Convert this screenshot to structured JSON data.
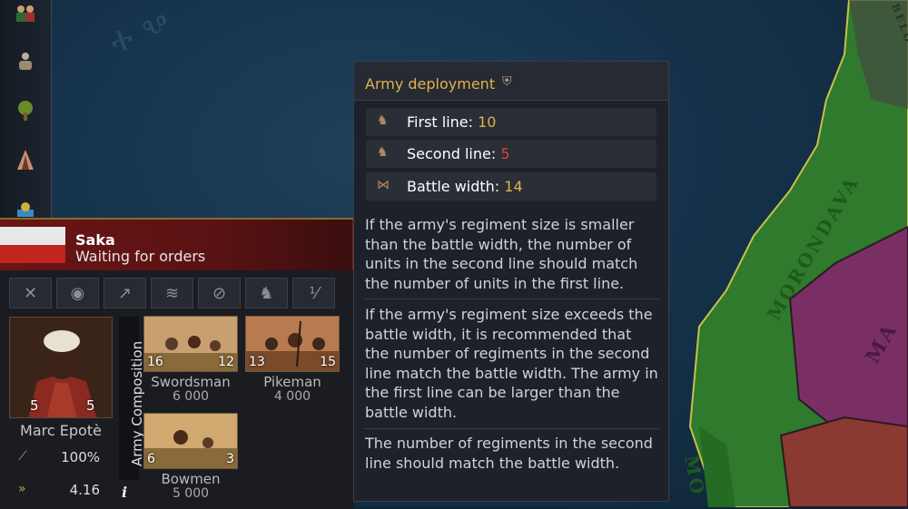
{
  "map": {
    "labels": [
      "MORONDAVA",
      "MA",
      "MO",
      "BELO"
    ]
  },
  "sidebar": {
    "buttons": [
      {
        "name": "royal-court-icon",
        "glyph": "👥"
      },
      {
        "name": "military-icon",
        "glyph": "⚔"
      },
      {
        "name": "tree-icon",
        "glyph": "🌳"
      },
      {
        "name": "religion-icon",
        "glyph": "⛺"
      },
      {
        "name": "economy-icon",
        "glyph": "⚖"
      }
    ]
  },
  "army": {
    "name": "Saka",
    "status": "Waiting for orders",
    "actions": [
      {
        "name": "attack-icon",
        "glyph": "✕"
      },
      {
        "name": "location-icon",
        "glyph": "◉"
      },
      {
        "name": "raise-icon",
        "glyph": "↗"
      },
      {
        "name": "formation-icon",
        "glyph": "≋"
      },
      {
        "name": "disband-icon",
        "glyph": "⊘"
      },
      {
        "name": "recruit-icon",
        "glyph": "♞"
      },
      {
        "name": "split-icon",
        "glyph": "⅟"
      }
    ],
    "commander": {
      "name": "Marc Epotè",
      "martial": "5",
      "defense": "5",
      "morale_label": "100%",
      "speed_label": "4.16"
    },
    "composition_label": "Army Composition",
    "info_label": "i",
    "units": [
      {
        "name": "Swordsman",
        "count": "6 000",
        "regiments": "16",
        "max": "12"
      },
      {
        "name": "Pikeman",
        "count": "4 000",
        "regiments": "13",
        "max": "15"
      },
      {
        "name": "Bowmen",
        "count": "5 000",
        "regiments": "6",
        "max": "3"
      }
    ]
  },
  "tooltip": {
    "title": "Army deployment",
    "rows": [
      {
        "label": "First line: ",
        "value": "10",
        "color": "#e0b34a",
        "icon": "first-line-icon"
      },
      {
        "label": "Second line: ",
        "value": "5",
        "color": "#e0403a",
        "icon": "second-line-icon"
      },
      {
        "label": "Battle width: ",
        "value": "14",
        "color": "#e0b34a",
        "icon": "battle-width-icon"
      }
    ],
    "paragraphs": [
      "If the army's regiment size is smaller than the battle width, the number of units in the second line should match the number of units in the first line.",
      "If the army's regiment size exceeds the battle width, it is recommended that the number of regiments in the second line match the battle width. The army in the first line can be larger than the battle width.",
      "The number of regiments in the second line should match the battle width."
    ]
  },
  "colors": {
    "accent_gold": "#e0b34a",
    "warning_red": "#e0403a",
    "header_red": "#6b1514",
    "land_green": "#2f7a2c",
    "land_purple": "#7a2f64"
  }
}
